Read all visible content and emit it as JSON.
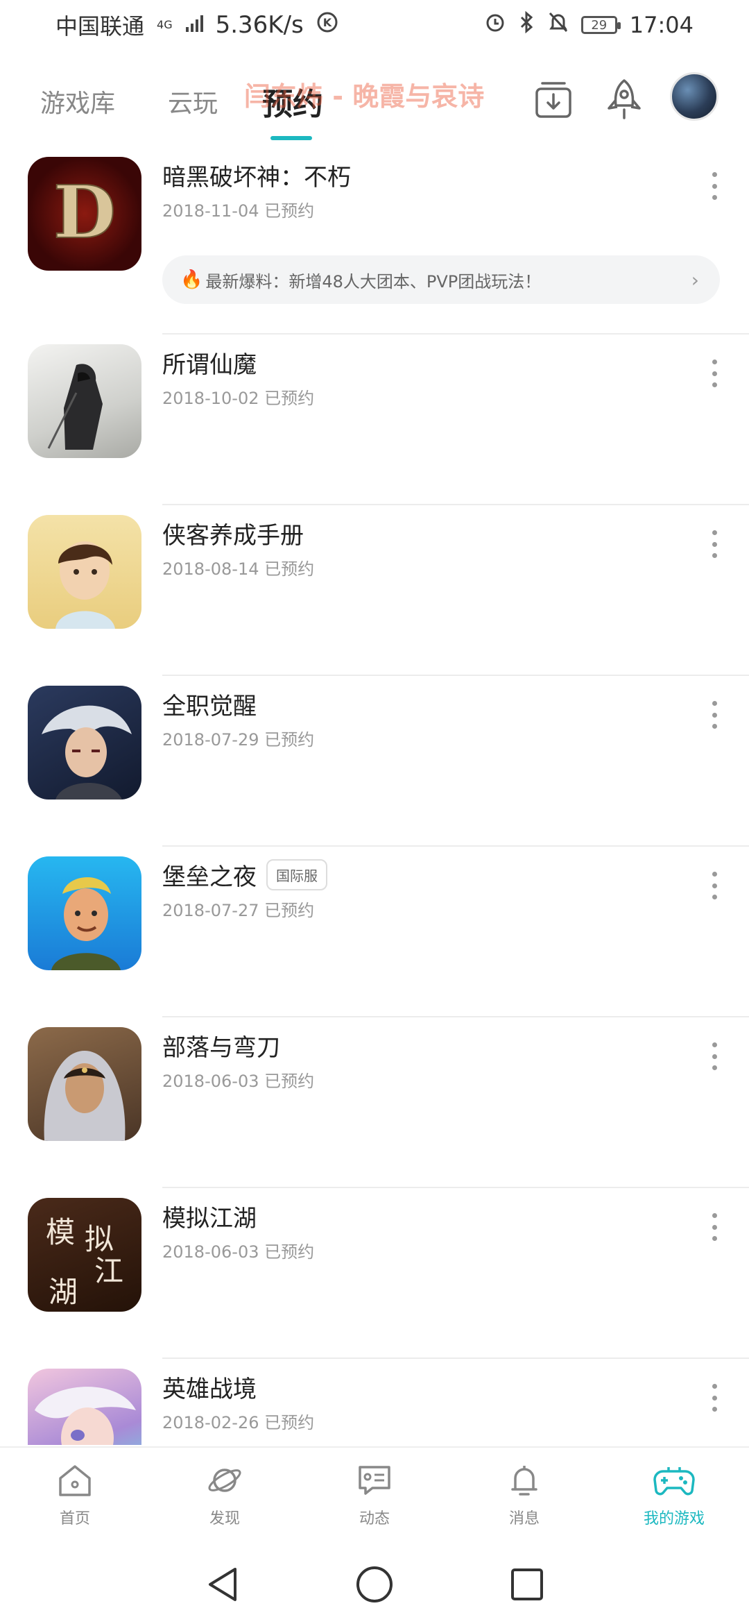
{
  "status_bar": {
    "carrier": "中国联通",
    "network": "4G",
    "speed": "5.36K/s",
    "battery": "29",
    "time": "17:04"
  },
  "top_nav": {
    "tabs": [
      "游戏库",
      "云玩",
      "预约"
    ],
    "active_tab": "预约",
    "watermark": "闫东炜 - 晚霞与哀诗"
  },
  "accent_color": "#1cb8c0",
  "games": [
    {
      "name": "暗黑破坏神：不朽",
      "date": "2018-11-04 已预约",
      "tag": "",
      "news": "最新爆料：新增48人大团本、PVP团战玩法！",
      "icon": "diablo-d-icon"
    },
    {
      "name": "所谓仙魔",
      "date": "2018-10-02 已预约",
      "tag": "",
      "icon": "swordsman-ink-icon"
    },
    {
      "name": "侠客养成手册",
      "date": "2018-08-14 已预约",
      "tag": "",
      "icon": "young-hero-icon"
    },
    {
      "name": "全职觉醒",
      "date": "2018-07-29 已预约",
      "tag": "",
      "icon": "white-hair-hero-icon"
    },
    {
      "name": "堡垒之夜",
      "date": "2018-07-27 已预约",
      "tag": "国际服",
      "icon": "fortnite-hero-icon"
    },
    {
      "name": "部落与弯刀",
      "date": "2018-06-03 已预约",
      "tag": "",
      "icon": "hooded-woman-icon"
    },
    {
      "name": "模拟江湖",
      "date": "2018-06-03 已预约",
      "tag": "",
      "icon": "calligraphy-icon",
      "icon_text": "模拟江湖"
    },
    {
      "name": "英雄战境",
      "date": "2018-02-26 已预约",
      "tag": "",
      "icon": "anime-girl-icon"
    }
  ],
  "bottom_nav": [
    {
      "label": "首页",
      "icon": "home-icon"
    },
    {
      "label": "发现",
      "icon": "planet-icon"
    },
    {
      "label": "动态",
      "icon": "feed-icon"
    },
    {
      "label": "消息",
      "icon": "bell-icon"
    },
    {
      "label": "我的游戏",
      "icon": "gamepad-icon",
      "active": true
    }
  ]
}
